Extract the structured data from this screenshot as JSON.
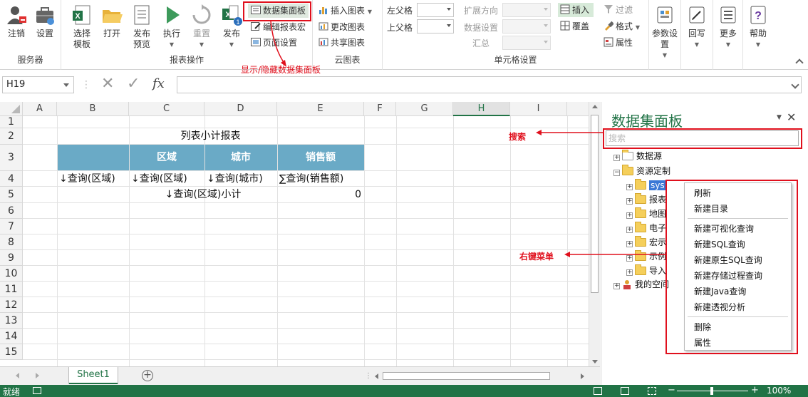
{
  "ribbon": {
    "server": {
      "logout": "注销",
      "settings": "设置",
      "label": "服务器"
    },
    "report_ops": {
      "select_template_line1": "选择",
      "select_template_line2": "模板",
      "open": "打开",
      "publish_preview_line1": "发布",
      "publish_preview_line2": "预览",
      "execute": "执行",
      "redo": "重置",
      "publish": "发布",
      "dataset_panel": "数据集面板",
      "edit_report": "编辑报表宏",
      "page_setup": "页面设置",
      "label": "报表操作"
    },
    "cloud_chart": {
      "insert_chart": "插入图表",
      "change_chart": "更改图表",
      "share_chart": "共享图表",
      "label": "云图表"
    },
    "cell_settings": {
      "left_parent": "左父格",
      "top_parent": "上父格",
      "expand_dir": "扩展方向",
      "data_settings": "数据设置",
      "summary": "汇总",
      "insert": "插入",
      "overwrite": "覆盖",
      "filter": "过滤",
      "format": "格式",
      "properties": "属性",
      "label": "单元格设置"
    },
    "param_settings_line1": "参数设",
    "param_settings_line2": "置",
    "writeback": "回写",
    "more": "更多",
    "help": "帮助"
  },
  "formula_bar": {
    "cell_ref": "H19",
    "fx": "fx",
    "value": ""
  },
  "sheet": {
    "columns": [
      "A",
      "B",
      "C",
      "D",
      "E",
      "F",
      "G",
      "H",
      "I"
    ],
    "rows": [
      "1",
      "2",
      "3",
      "4",
      "5",
      "6",
      "7",
      "8",
      "9",
      "10",
      "11",
      "12",
      "13",
      "14",
      "15"
    ],
    "title": "列表小计报表",
    "headers": [
      "区域",
      "城市",
      "销售额"
    ],
    "row4": [
      "↓查询(区域)",
      "↓查询(区域)",
      "↓查询(城市)",
      "∑查询(销售额)"
    ],
    "row5_label": "↓查询(区域)小计",
    "row5_value": "0",
    "tab_name": "Sheet1",
    "add_sheet": "⊕"
  },
  "status_bar": {
    "ready": "就绪",
    "zoom": "100%",
    "minus": "−",
    "plus": "+"
  },
  "panel": {
    "title": "数据集面板",
    "search_placeholder": "搜索",
    "tree": {
      "datasource": "数据源",
      "resource_custom": "资源定制",
      "children": [
        "sys",
        "报表",
        "地图",
        "电子",
        "宏示",
        "示例",
        "导入"
      ],
      "my_space": "我的空间"
    }
  },
  "context_menu": {
    "refresh": "刷新",
    "new_folder": "新建目录",
    "new_visual_query": "新建可视化查询",
    "new_sql_query": "新建SQL查询",
    "new_native_sql_query": "新建原生SQL查询",
    "new_proc_query": "新建存储过程查询",
    "new_java_query": "新建Java查询",
    "new_pivot": "新建透视分析",
    "delete": "删除",
    "properties": "属性"
  },
  "annotations": {
    "toggle_panel": "显示/隐藏数据集面板",
    "search": "搜索",
    "context_menu": "右键菜单"
  },
  "colors": {
    "accent_green": "#217346",
    "header_band": "#6aaac6",
    "annotation_red": "#e0101d"
  }
}
